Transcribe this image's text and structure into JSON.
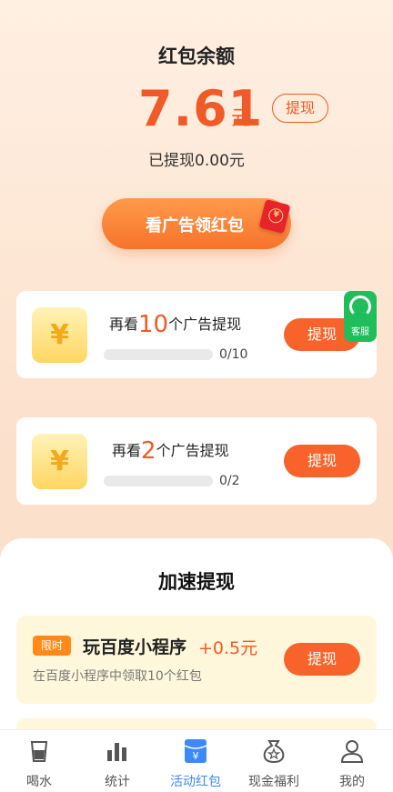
{
  "balance": {
    "title": "红包余额",
    "amount": "7.61",
    "unit": "元",
    "withdraw_label": "提现",
    "withdrawn_text": "已提现0.00元"
  },
  "watch_ad": {
    "label": "看广告领红包"
  },
  "tasks": [
    {
      "prefix": "再看",
      "count": "10",
      "suffix": "个广告提现",
      "progress_text": "0/10",
      "progress": 0,
      "button": "提现"
    },
    {
      "prefix": "再看",
      "count": "2",
      "suffix": "个广告提现",
      "progress_text": "0/2",
      "progress": 0,
      "button": "提现"
    }
  ],
  "service": {
    "label": "客服"
  },
  "accelerate": {
    "title": "加速提现",
    "item": {
      "badge": "限时",
      "name": "玩百度小程序",
      "reward": "+0.5元",
      "desc": "在百度小程序中领取10个红包",
      "button": "提现"
    }
  },
  "tabs": [
    {
      "label": "喝水",
      "icon": "cup-icon"
    },
    {
      "label": "统计",
      "icon": "bar-chart-icon"
    },
    {
      "label": "活动红包",
      "icon": "redpack-icon",
      "active": true
    },
    {
      "label": "现金福利",
      "icon": "money-bag-icon"
    },
    {
      "label": "我的",
      "icon": "user-icon"
    }
  ],
  "colors": {
    "accent": "#f05a28",
    "tab_active": "#3d8af7",
    "service": "#1fbe5a"
  }
}
